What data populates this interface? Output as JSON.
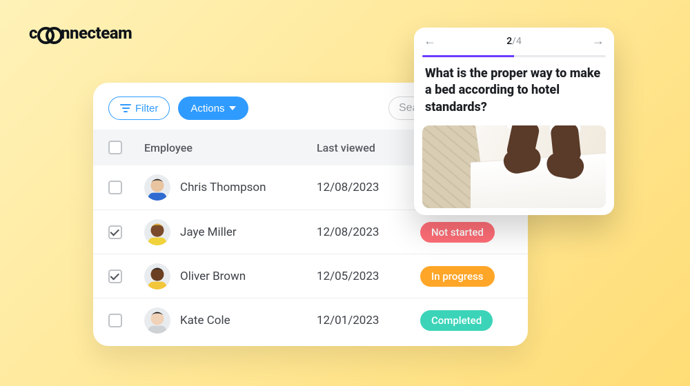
{
  "brand": "nnecteam",
  "toolbar": {
    "filter_label": "Filter",
    "actions_label": "Actions",
    "search_placeholder": "Search"
  },
  "columns": {
    "employee": "Employee",
    "last_viewed": "Last viewed"
  },
  "status_colors": {
    "not_started": "#ff6e77",
    "in_progress": "#ffa629",
    "completed": "#3bd4b9"
  },
  "rows": [
    {
      "name": "Chris Thompson",
      "date": "12/08/2023",
      "checked": false,
      "status": "",
      "avatar": {
        "skin": "#e8c4a0",
        "hair": "#2b2b2b",
        "shirt": "#2f6bd1"
      }
    },
    {
      "name": "Jaye Miller",
      "date": "12/08/2023",
      "checked": true,
      "status": "Not started",
      "status_key": "not_started",
      "avatar": {
        "skin": "#7a4a2a",
        "hair": "#e8b63c",
        "shirt": "#f0d23a"
      }
    },
    {
      "name": "Oliver Brown",
      "date": "12/05/2023",
      "checked": true,
      "status": "In progress",
      "status_key": "in_progress",
      "avatar": {
        "skin": "#6b3f22",
        "hair": "#2b2b2b",
        "shirt": "#f2c63a"
      }
    },
    {
      "name": "Kate Cole",
      "date": "12/01/2023",
      "checked": false,
      "status": "Completed",
      "status_key": "completed",
      "avatar": {
        "skin": "#f0d2b8",
        "hair": "#1f1f1f",
        "shirt": "#cfd2d5"
      }
    }
  ],
  "quiz": {
    "current": "2",
    "total": "4",
    "sep": "/",
    "progress_pct": 50,
    "question": "What is the proper way to make a bed according to hotel standards?"
  }
}
